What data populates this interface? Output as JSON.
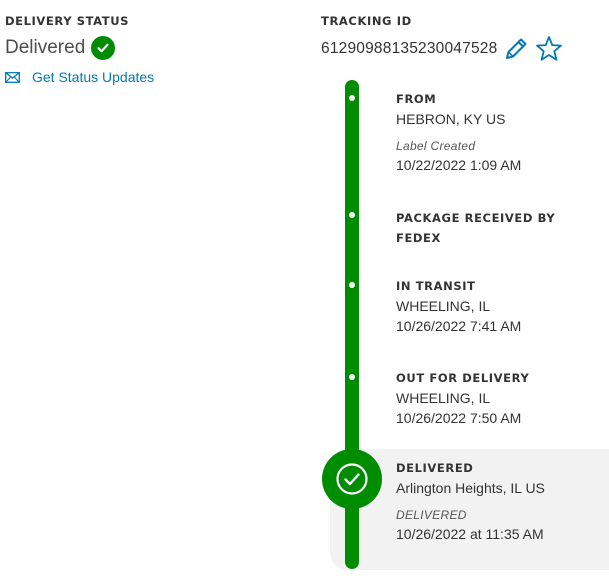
{
  "delivery": {
    "heading": "DELIVERY STATUS",
    "status": "Delivered",
    "status_updates_link": "Get Status Updates"
  },
  "tracking": {
    "heading": "TRACKING ID",
    "number": "612909881352300475 28"
  },
  "timeline": {
    "from": {
      "title": "FROM",
      "location": "HEBRON, KY US",
      "sub_label": "Label Created",
      "datetime": "10/22/2022 1:09 AM"
    },
    "received": {
      "title_line1": "PACKAGE RECEIVED BY",
      "title_line2": "FEDEX"
    },
    "in_transit": {
      "title": "IN TRANSIT",
      "location": "WHEELING, IL",
      "datetime": "10/26/2022 7:41 AM"
    },
    "out_for_delivery": {
      "title": "OUT FOR DELIVERY",
      "location": "WHEELING, IL",
      "datetime": "10/26/2022 7:50 AM"
    },
    "delivered": {
      "title": "DELIVERED",
      "location": "Arlington Heights, IL US",
      "sub_label": "DELIVERED",
      "datetime": "10/26/2022 at 11:35 AM"
    }
  },
  "colors": {
    "green": "#008c00",
    "link_blue": "#007ab7",
    "panel_gray": "#f2f2f2"
  },
  "icons": {
    "status_check": "check-circle-icon",
    "email": "envelope-icon",
    "edit": "pencil-icon",
    "favorite": "star-outline-icon",
    "delivered": "check-circle-icon"
  }
}
